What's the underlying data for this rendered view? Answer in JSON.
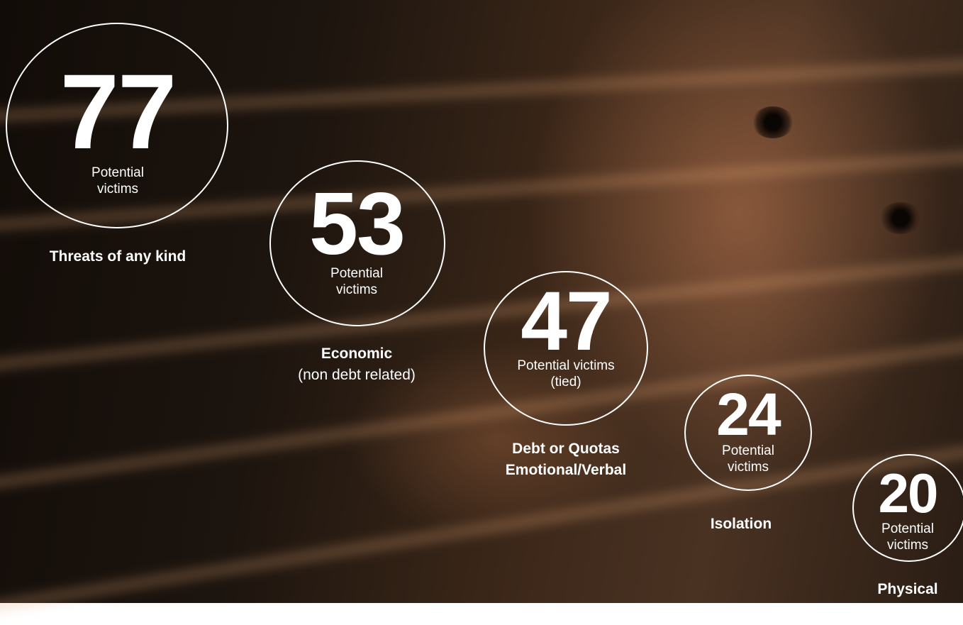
{
  "stats": [
    {
      "number": "77",
      "sub_line1": "Potential",
      "sub_line2": "victims",
      "label_line1": "Threats of any kind",
      "label_line2": ""
    },
    {
      "number": "53",
      "sub_line1": "Potential",
      "sub_line2": "victims",
      "label_line1": "Economic",
      "label_line2": "(non debt related)"
    },
    {
      "number": "47",
      "sub_line1": "Potential victims",
      "sub_line2": "(tied)",
      "label_line1": "Debt or Quotas",
      "label_line2": "Emotional/Verbal"
    },
    {
      "number": "24",
      "sub_line1": "Potential",
      "sub_line2": "victims",
      "label_line1": "Isolation",
      "label_line2": ""
    },
    {
      "number": "20",
      "sub_line1": "Potential",
      "sub_line2": "victims",
      "label_line1": "Physical",
      "label_line2": ""
    }
  ],
  "colors": {
    "text": "#ffffff",
    "circle_stroke": "#ffffff",
    "background": "#2a1d14"
  }
}
